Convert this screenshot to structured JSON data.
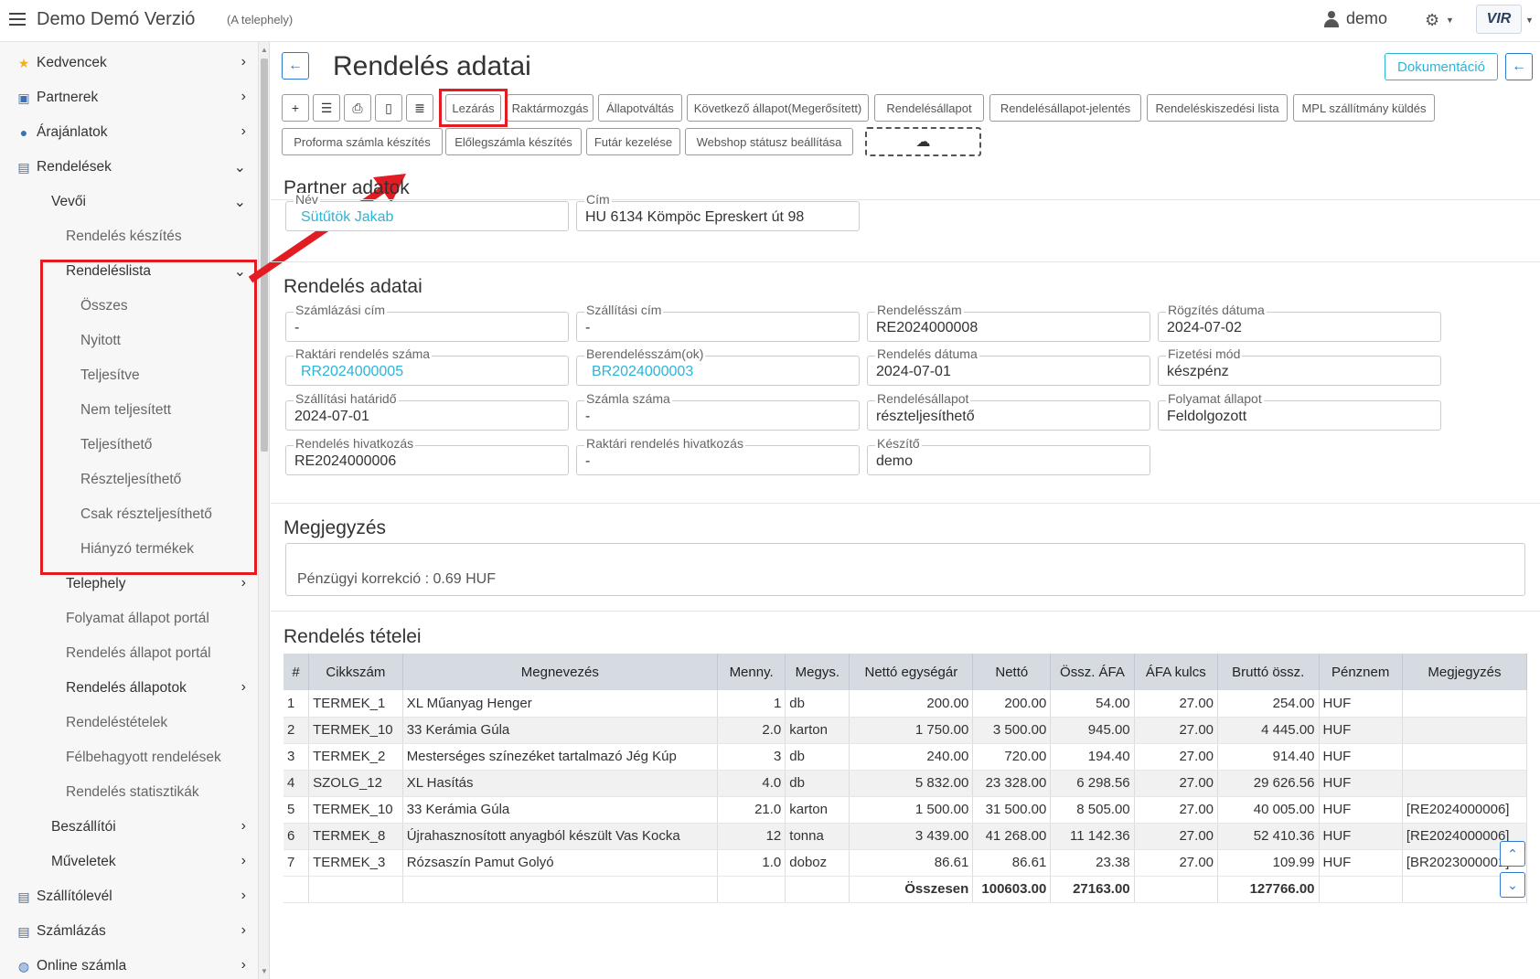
{
  "header": {
    "app_title": "Demo Demó Verzió",
    "app_subtitle": "(A telephely)",
    "user": "demo",
    "logo_text": "VIR"
  },
  "sidebar": {
    "items": [
      {
        "label": "Kedvencek",
        "icon": "star-icon"
      },
      {
        "label": "Partnerek",
        "icon": "contact-icon"
      },
      {
        "label": "Árajánlatok",
        "icon": "chat-icon"
      },
      {
        "label": "Rendelések",
        "icon": "document-icon"
      },
      {
        "label": "Vevői"
      },
      {
        "label": "Rendelés készítés"
      },
      {
        "label": "Rendeléslista"
      },
      {
        "label": "Összes"
      },
      {
        "label": "Nyitott"
      },
      {
        "label": "Teljesítve"
      },
      {
        "label": "Nem teljesített"
      },
      {
        "label": "Teljesíthető"
      },
      {
        "label": "Részteljesíthető"
      },
      {
        "label": "Csak részteljesíthető"
      },
      {
        "label": "Hiányzó termékek"
      },
      {
        "label": "Telephely"
      },
      {
        "label": "Folyamat állapot portál"
      },
      {
        "label": "Rendelés állapot portál"
      },
      {
        "label": "Rendelés állapotok"
      },
      {
        "label": "Rendeléstételek"
      },
      {
        "label": "Félbehagyott rendelések"
      },
      {
        "label": "Rendelés statisztikák"
      },
      {
        "label": "Beszállítói"
      },
      {
        "label": "Műveletek"
      },
      {
        "label": "Szállítólevél",
        "icon": "document-icon"
      },
      {
        "label": "Számlázás",
        "icon": "document-icon"
      },
      {
        "label": "Online számla",
        "icon": "globe-icon"
      }
    ]
  },
  "main": {
    "title": "Rendelés adatai",
    "doc_button": "Dokumentáció",
    "toolbar": [
      "Lezárás",
      "Raktármozgás",
      "Állapotváltás",
      "Következő állapot(Megerősített)",
      "Rendelésállapot",
      "Rendelésállapot-jelentés",
      "Rendeléskiszedési lista",
      "MPL szállítmány küldés",
      "Proforma számla készítés",
      "Előlegszámla készítés",
      "Futár kezelése",
      "Webshop státusz beállítása"
    ],
    "partner": {
      "title": "Partner adatok",
      "name_label": "Név",
      "name_value": "Sütűtök Jakab",
      "address_label": "Cím",
      "address_value": "HU 6134 Kömpöc Epreskert út 98"
    },
    "order": {
      "title": "Rendelés adatai",
      "fields": [
        {
          "label": "Számlázási cím",
          "value": "-"
        },
        {
          "label": "Szállítási cím",
          "value": "-"
        },
        {
          "label": "Rendelésszám",
          "value": "RE2024000008"
        },
        {
          "label": "Rögzítés dátuma",
          "value": "2024-07-02"
        },
        {
          "label": "Raktári rendelés száma",
          "value": "RR2024000005"
        },
        {
          "label": "Berendelésszám(ok)",
          "value": "BR2024000003"
        },
        {
          "label": "Rendelés dátuma",
          "value": "2024-07-01"
        },
        {
          "label": "Fizetési mód",
          "value": "készpénz"
        },
        {
          "label": "Szállítási határidő",
          "value": "2024-07-01"
        },
        {
          "label": "Számla száma",
          "value": "-"
        },
        {
          "label": "Rendelésállapot",
          "value": "részteljesíthető"
        },
        {
          "label": "Folyamat állapot",
          "value": "Feldolgozott"
        },
        {
          "label": "Rendelés hivatkozás",
          "value": "RE2024000006"
        },
        {
          "label": "Raktári rendelés hivatkozás",
          "value": "-"
        },
        {
          "label": "Készítő",
          "value": "demo"
        }
      ]
    },
    "note": {
      "title": "Megjegyzés",
      "value": "Pénzügyi korrekció : 0.69 HUF"
    },
    "items": {
      "title": "Rendelés tételei",
      "headers": [
        "#",
        "Cikkszám",
        "Megnevezés",
        "Menny.",
        "Megys.",
        "Nettó egységár",
        "Nettó",
        "Össz. ÁFA",
        "ÁFA kulcs",
        "Bruttó össz.",
        "Pénznem",
        "Megjegyzés"
      ],
      "rows": [
        [
          "1",
          "TERMEK_1",
          "XL Műanyag Henger",
          "1",
          "db",
          "200.00",
          "200.00",
          "54.00",
          "27.00",
          "254.00",
          "HUF",
          ""
        ],
        [
          "2",
          "TERMEK_10",
          "33 Kerámia Gúla",
          "2.0",
          "karton",
          "1 750.00",
          "3 500.00",
          "945.00",
          "27.00",
          "4 445.00",
          "HUF",
          ""
        ],
        [
          "3",
          "TERMEK_2",
          "Mesterséges színezéket tartalmazó Jég Kúp",
          "3",
          "db",
          "240.00",
          "720.00",
          "194.40",
          "27.00",
          "914.40",
          "HUF",
          ""
        ],
        [
          "4",
          "SZOLG_12",
          "XL Hasítás",
          "4.0",
          "db",
          "5 832.00",
          "23 328.00",
          "6 298.56",
          "27.00",
          "29 626.56",
          "HUF",
          ""
        ],
        [
          "5",
          "TERMEK_10",
          "33 Kerámia Gúla",
          "21.0",
          "karton",
          "1 500.00",
          "31 500.00",
          "8 505.00",
          "27.00",
          "40 005.00",
          "HUF",
          "[RE2024000006]"
        ],
        [
          "6",
          "TERMEK_8",
          "Újrahasznosított anyagból készült Vas Kocka",
          "12",
          "tonna",
          "3 439.00",
          "41 268.00",
          "11 142.36",
          "27.00",
          "52 410.36",
          "HUF",
          "[RE2024000006]"
        ],
        [
          "7",
          "TERMEK_3",
          "Rózsaszín Pamut Golyó",
          "1.0",
          "doboz",
          "86.61",
          "86.61",
          "23.38",
          "27.00",
          "109.99",
          "HUF",
          "[BR2023000001]"
        ]
      ],
      "total_label": "Összesen",
      "total_net": "100603.00",
      "total_vat": "27163.00",
      "total_gross": "127766.00"
    }
  }
}
